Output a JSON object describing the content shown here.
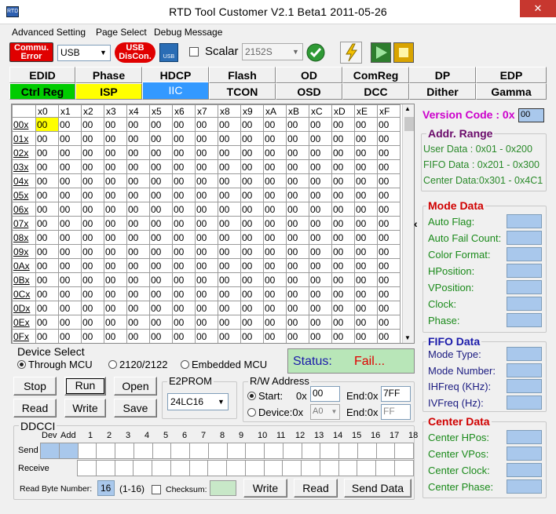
{
  "window": {
    "title": "RTD Tool Customer V2.1 Beta1    2011-05-26",
    "icon_text": "RTD",
    "close": "✕"
  },
  "menu": [
    "Advanced Setting",
    "Page Select",
    "Debug Message"
  ],
  "toolbar": {
    "commu_error": "Commu. Error",
    "interface": "USB",
    "usb_disconnect": "USB DisCon.",
    "usb_label": "USB",
    "scalar_label": "Scalar",
    "scalar_value": "2152S"
  },
  "tabs_row1": [
    "EDID",
    "Phase",
    "HDCP",
    "Flash",
    "OD",
    "ComReg",
    "DP",
    "EDP"
  ],
  "tabs_row2": [
    "Ctrl Reg",
    "ISP",
    "IIC",
    "TCON",
    "OSD",
    "DCC",
    "Dither",
    "Gamma"
  ],
  "tab_colors": {
    "ctrl_reg": "#00cc00",
    "isp": "#ffff00",
    "iic": "#3399ff"
  },
  "grid": {
    "columns": [
      "x0",
      "x1",
      "x2",
      "x3",
      "x4",
      "x5",
      "x6",
      "x7",
      "x8",
      "x9",
      "xA",
      "xB",
      "xC",
      "xD",
      "xE",
      "xF"
    ],
    "rows": [
      "00x",
      "01x",
      "02x",
      "03x",
      "04x",
      "05x",
      "06x",
      "07x",
      "08x",
      "09x",
      "0Ax",
      "0Bx",
      "0Cx",
      "0Dx",
      "0Ex",
      "0Fx"
    ],
    "default_value": "00",
    "highlight_color": "#ffff00"
  },
  "right": {
    "version_label": "Version Code : 0x",
    "version_value": "00",
    "addr_title": "Addr. Range",
    "addr_lines": [
      "User Data : 0x01 - 0x200",
      "FIFO Data : 0x201 - 0x300",
      "Center Data:0x301 - 0x4C1"
    ],
    "mode_title": "Mode Data",
    "mode_items": [
      "Auto Flag:",
      "Auto Fail Count:",
      "Color Format:",
      "HPosition:",
      "VPosition:",
      "Clock:",
      "Phase:"
    ],
    "fifo_title": "FIFO Data",
    "fifo_items": [
      "Mode Type:",
      "Mode Number:",
      "IHFreq (KHz):",
      "IVFreq (Hz):"
    ],
    "center_title": "Center Data",
    "center_items": [
      "Center HPos:",
      "Center VPos:",
      "Center Clock:",
      "Center Phase:"
    ],
    "collapse_arrow": "‹"
  },
  "device_select": {
    "title": "Device Select",
    "options": [
      "Through MCU",
      "2120/2122",
      "Embedded MCU"
    ],
    "selected": 0
  },
  "status": {
    "label": "Status:",
    "value": "Fail..."
  },
  "buttons": {
    "stop": "Stop",
    "run": "Run",
    "open": "Open",
    "read": "Read",
    "write": "Write",
    "save": "Save"
  },
  "e2prom": {
    "title": "E2PROM",
    "value": "24LC16"
  },
  "rw": {
    "title": "R/W Address",
    "start_label": "Start:",
    "start_prefix": "0x",
    "start_value": "00",
    "end_label": "End:0x",
    "end_value": "7FF",
    "device_label": "Device:0x",
    "device_value": "A0",
    "end2_value": "FF",
    "selected": "start"
  },
  "ddcci": {
    "title": "DDCCI",
    "headers": [
      "Dev",
      "Add",
      "1",
      "2",
      "3",
      "4",
      "5",
      "6",
      "7",
      "8",
      "9",
      "10",
      "11",
      "12",
      "13",
      "14",
      "15",
      "16",
      "17",
      "18"
    ],
    "send_label": "Send",
    "receive_label": "Receive",
    "read_byte_label": "Read Byte Number:",
    "read_byte_value": "16",
    "read_byte_range": "(1-16)",
    "checksum_label": "Checksum:",
    "write": "Write",
    "read": "Read",
    "send_data": "Send Data"
  }
}
